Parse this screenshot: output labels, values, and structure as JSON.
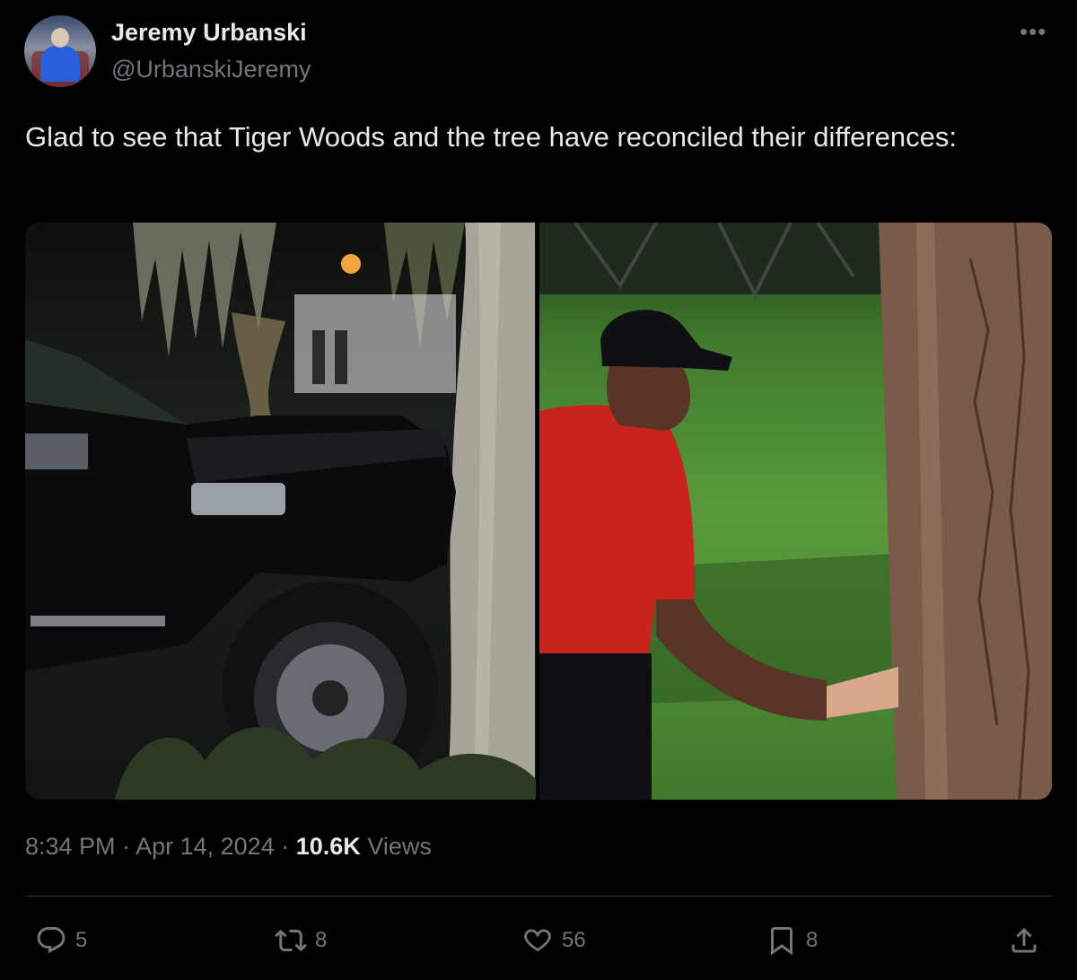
{
  "author": {
    "display_name": "Jeremy Urbanski",
    "handle": "@UrbanskiJeremy"
  },
  "tweet": {
    "text": "Glad to see that Tiger Woods and the tree have reconciled their differences:",
    "time": "8:34 PM",
    "date": "Apr 14, 2024",
    "views_count": "10.6K",
    "views_label": "Views"
  },
  "media": {
    "left_image": "black SUV crashed into a tree at night",
    "right_image": "golfer in red shirt shaking a hand coming out of a tree trunk"
  },
  "actions": {
    "replies": "5",
    "reposts": "8",
    "likes": "56",
    "bookmarks": "8"
  },
  "icons": [
    "more-icon",
    "reply-icon",
    "repost-icon",
    "like-icon",
    "bookmark-icon",
    "share-icon"
  ],
  "colors": {
    "background": "#000000",
    "text_primary": "#e7e9ea",
    "text_secondary": "#71767b",
    "divider": "#2f3336"
  }
}
